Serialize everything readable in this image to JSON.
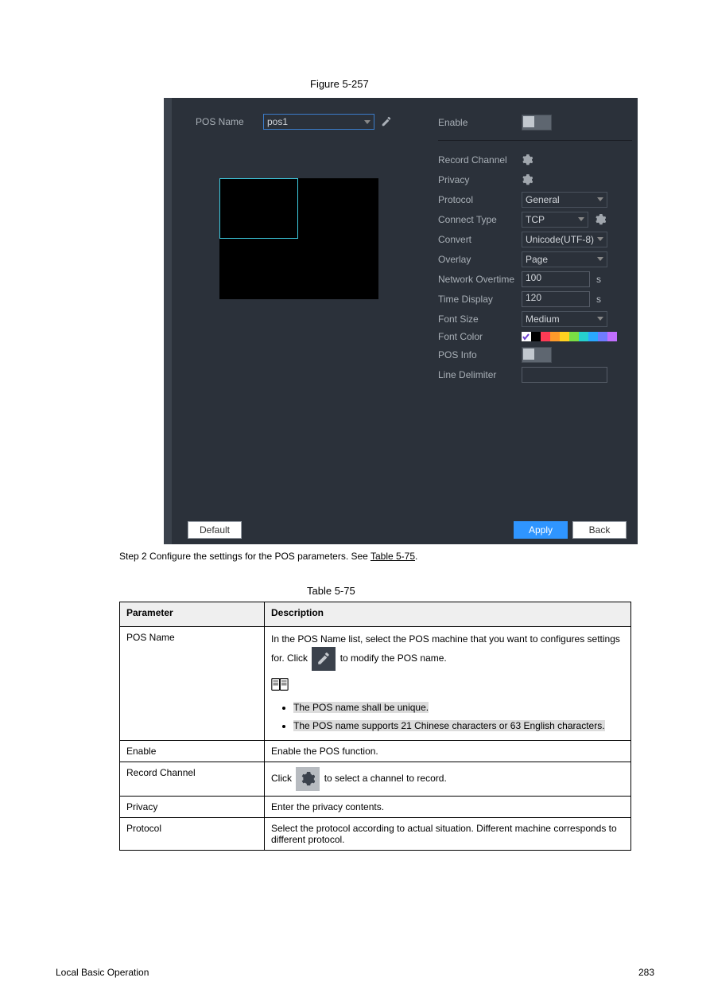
{
  "figure_label": "Figure 5-257",
  "dialog": {
    "pos_name_label": "POS Name",
    "pos_name_value": "pos1",
    "enable_label": "Enable",
    "record_channel_label": "Record Channel",
    "privacy_label": "Privacy",
    "protocol_label": "Protocol",
    "protocol_value": "General",
    "connect_type_label": "Connect Type",
    "connect_type_value": "TCP",
    "convert_label": "Convert",
    "convert_value": "Unicode(UTF-8)",
    "overlay_label": "Overlay",
    "overlay_value": "Page",
    "network_overtime_label": "Network Overtime",
    "network_overtime_value": "100",
    "network_overtime_unit": "s",
    "time_display_label": "Time Display",
    "time_display_value": "120",
    "time_display_unit": "s",
    "font_size_label": "Font Size",
    "font_size_value": "Medium",
    "font_color_label": "Font Color",
    "pos_info_label": "POS Info",
    "line_delimiter_label": "Line Delimiter",
    "default_btn": "Default",
    "apply_btn": "Apply",
    "back_btn": "Back",
    "colors": [
      "#ffffff",
      "#000000",
      "#ff3b55",
      "#ff9a2a",
      "#ffd220",
      "#7ade44",
      "#26d0ce",
      "#2aa8ff",
      "#6f7cff",
      "#c26fff"
    ]
  },
  "step_text_prefix": "Step 2   Configure the settings for the POS parameters. See ",
  "step_text_ref": "Table 5-75",
  "step_text_suffix": ".",
  "table_label": "Table 5-75",
  "table": {
    "h_param": "Parameter",
    "h_desc": "Description",
    "posname_param": "POS Name",
    "posname_d1_a": "In the POS Name list, select the POS machine that you want to configures settings for. Click ",
    "posname_d1_b": " to modify the POS name.",
    "posname_note1": "The POS name shall be unique.",
    "posname_note2": "The POS name supports 21 Chinese characters or 63 English characters.",
    "enable_param": "Enable",
    "enable_desc": "Enable the POS function.",
    "record_param": "Record Channel",
    "record_d_a": "Click ",
    "record_d_b": " to select a channel to record.",
    "privacy_param": "Privacy",
    "privacy_desc": "Enter the privacy contents.",
    "protocol_param": "Protocol",
    "protocol_desc": "Select the protocol according to actual situation. Different machine corresponds to different protocol."
  },
  "page_number": "283",
  "book_title": "Local Basic Operation"
}
